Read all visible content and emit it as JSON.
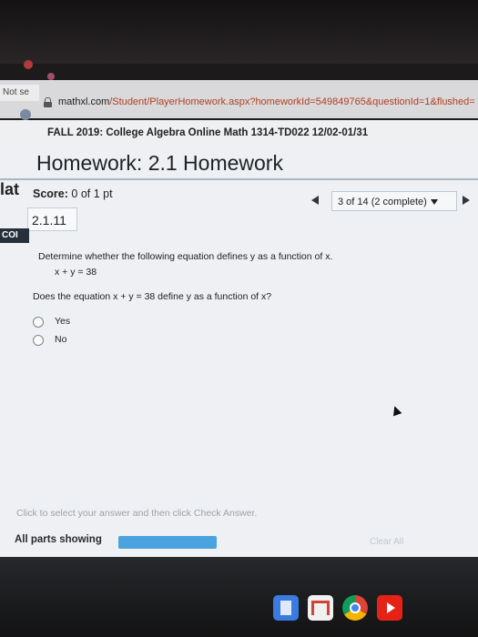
{
  "browser": {
    "security_label": "Not se",
    "url_host": "mathxl.com",
    "url_path": "/Student/PlayerHomework.aspx?homeworkId=549849765&questionId=1&flushed="
  },
  "course": {
    "title": "FALL 2019: College Algebra Online Math 1314-TD022 12/02-01/31"
  },
  "homework": {
    "title": "Homework: 2.1 Homework",
    "left_fragment": "lat",
    "score_label": "Score:",
    "score_value": "0 of 1 pt",
    "question_counter": "3 of 14 (2 complete)",
    "question_number": "2.1.11",
    "side_tab_label": "COI"
  },
  "question": {
    "prompt": "Determine whether the following equation defines y as a function of x.",
    "equation": "x + y = 38",
    "sub_question": "Does the equation x + y = 38 define y as a function of x?",
    "options": [
      {
        "label": "Yes",
        "selected": false
      },
      {
        "label": "No",
        "selected": false
      }
    ]
  },
  "footer": {
    "instruction": "Click to select your answer and then click Check Answer.",
    "parts_showing": "All parts showing",
    "progress_fraction": 1.0,
    "clear_all": "Clear All"
  },
  "shelf": {
    "apps": [
      "docs-icon",
      "gmail-icon",
      "chrome-icon",
      "youtube-icon"
    ]
  },
  "colors": {
    "progress": "#4aa3dc",
    "url_path": "#b0401f"
  }
}
